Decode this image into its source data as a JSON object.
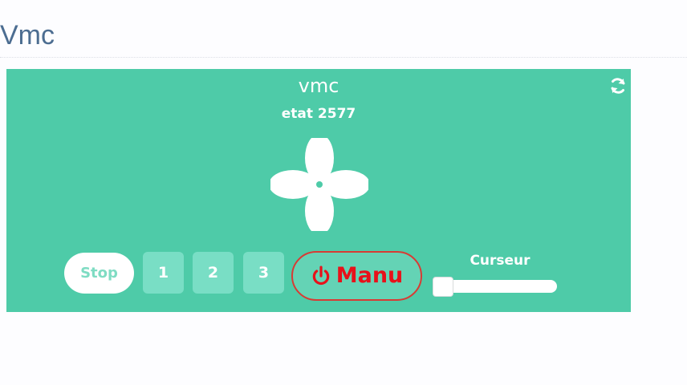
{
  "page": {
    "title": "Vmc"
  },
  "widget": {
    "title": "vmc",
    "status": "etat 2577",
    "refresh_icon": "refresh-icon",
    "fan_icon": "fan-icon",
    "buttons": {
      "stop": "Stop",
      "speed_1": "1",
      "speed_2": "2",
      "speed_3": "3",
      "manual": "Manu",
      "manual_icon": "power-icon"
    },
    "slider": {
      "label": "Curseur",
      "value_fraction": 0
    }
  },
  "colors": {
    "title": "#4c6d91",
    "widget_background": "#4ecba8",
    "speed_button": "#79dec5",
    "manual_text": "#e8111a",
    "manual_border": "#d83b34"
  }
}
